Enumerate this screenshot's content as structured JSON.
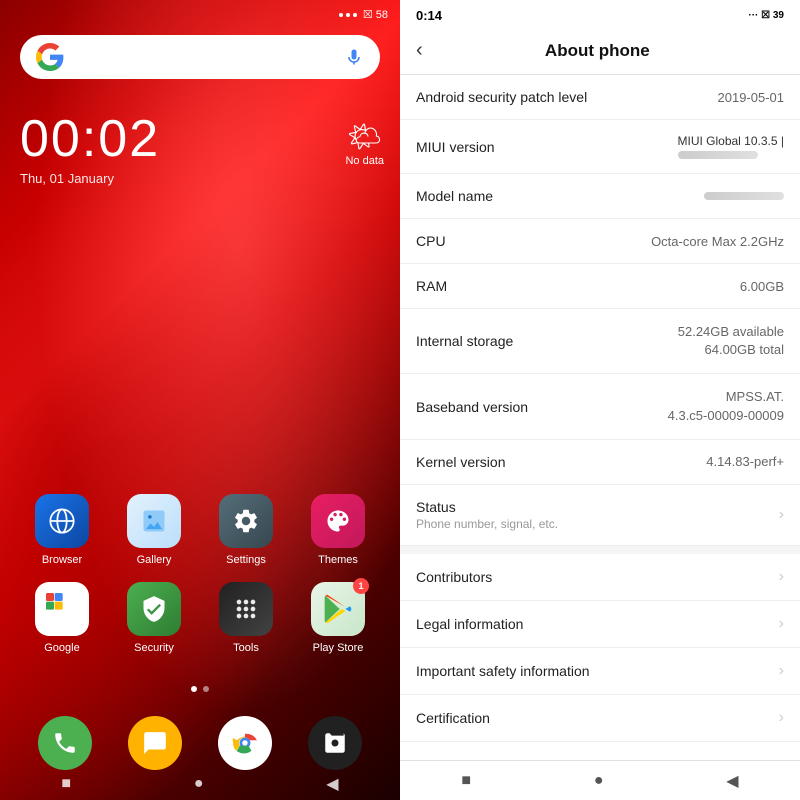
{
  "left": {
    "statusBar": {
      "icons": "··· ☒ 58"
    },
    "clock": {
      "time": "00:02",
      "date": "Thu, 01 January"
    },
    "weather": {
      "icon": "🌤",
      "label": "No data"
    },
    "apps": [
      {
        "id": "browser",
        "label": "Browser",
        "iconClass": "icon-browser",
        "icon": "🌐"
      },
      {
        "id": "gallery",
        "label": "Gallery",
        "iconClass": "icon-gallery",
        "icon": "🖼"
      },
      {
        "id": "settings",
        "label": "Settings",
        "iconClass": "icon-settings",
        "icon": "⚙"
      },
      {
        "id": "themes",
        "label": "Themes",
        "iconClass": "icon-themes",
        "icon": "🎨"
      },
      {
        "id": "google",
        "label": "Google",
        "iconClass": "icon-google",
        "icon": "G"
      },
      {
        "id": "security",
        "label": "Security",
        "iconClass": "icon-security",
        "icon": "🛡"
      },
      {
        "id": "tools",
        "label": "Tools",
        "iconClass": "icon-tools",
        "icon": "⚙"
      },
      {
        "id": "playstore",
        "label": "Play Store",
        "iconClass": "icon-playstore",
        "icon": "▶",
        "badge": "1"
      }
    ],
    "dock": [
      {
        "id": "phone",
        "label": "Phone",
        "iconClass": "dock-phone",
        "icon": "📞"
      },
      {
        "id": "message",
        "label": "Messages",
        "iconClass": "dock-message",
        "icon": "💬"
      },
      {
        "id": "chrome",
        "label": "Chrome",
        "iconClass": "dock-chrome",
        "icon": "🔵"
      },
      {
        "id": "camera",
        "label": "Camera",
        "iconClass": "dock-camera",
        "icon": "📷"
      }
    ],
    "nav": [
      "■",
      "●",
      "◀"
    ]
  },
  "right": {
    "statusBar": {
      "time": "0:14",
      "icons": "··· ☒ 39"
    },
    "header": {
      "backLabel": "‹",
      "title": "About phone"
    },
    "items": [
      {
        "label": "Android security patch level",
        "value": "2019-05-01",
        "hasChevron": false
      },
      {
        "label": "MIUI version",
        "value": "MIUI Global 10.3.5 |",
        "valueBlurred": "████████",
        "hasChevron": false
      },
      {
        "label": "Model name",
        "value": "",
        "valueBlurred": "████████",
        "hasChevron": false
      },
      {
        "label": "CPU",
        "value": "Octa-core Max 2.2GHz",
        "hasChevron": false
      },
      {
        "label": "RAM",
        "value": "6.00GB",
        "hasChevron": false
      },
      {
        "label": "Internal storage",
        "value": "52.24GB available\n64.00GB total",
        "hasChevron": false
      },
      {
        "label": "Baseband version",
        "value": "MPSS.AT.\n4.3.c5-00009-00009",
        "hasChevron": false
      },
      {
        "label": "Kernel version",
        "value": "4.14.83-perf+",
        "hasChevron": false
      },
      {
        "label": "Status",
        "sublabel": "Phone number, signal, etc.",
        "value": "",
        "hasChevron": true
      },
      {
        "label": "Contributors",
        "value": "",
        "hasChevron": true,
        "isSection": true
      },
      {
        "label": "Legal information",
        "value": "",
        "hasChevron": true
      },
      {
        "label": "Important safety information",
        "value": "",
        "hasChevron": true
      },
      {
        "label": "Certification",
        "value": "",
        "hasChevron": true
      }
    ],
    "nav": [
      "■",
      "●",
      "◀"
    ]
  }
}
